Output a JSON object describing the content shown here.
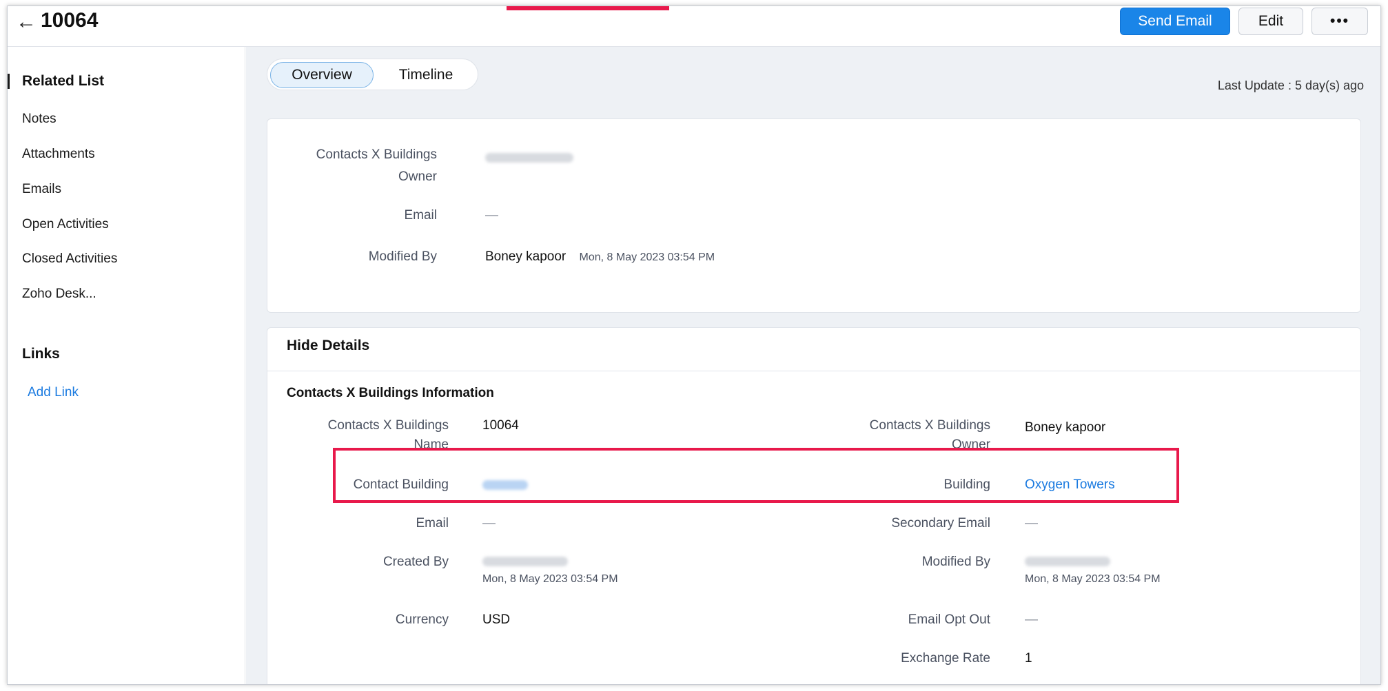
{
  "header": {
    "title": "10064",
    "send_email": "Send Email",
    "edit": "Edit",
    "more": "•••"
  },
  "sidebar": {
    "related_heading": "Related List",
    "items": [
      {
        "label": "Notes"
      },
      {
        "label": "Attachments"
      },
      {
        "label": "Emails"
      },
      {
        "label": "Open Activities"
      },
      {
        "label": "Closed Activities"
      },
      {
        "label": "Zoho Desk..."
      }
    ],
    "links_heading": "Links",
    "add_link": "Add Link"
  },
  "tabs": {
    "overview": "Overview",
    "timeline": "Timeline"
  },
  "last_update": "Last Update : 5 day(s) ago",
  "summary": {
    "owner_label_1": "Contacts X Buildings",
    "owner_label_2": "Owner",
    "email_label": "Email",
    "email_value": "—",
    "modified_by_label": "Modified By",
    "modified_by_value": "Boney kapoor",
    "modified_time": "Mon, 8 May 2023 03:54 PM"
  },
  "details": {
    "hide_details": "Hide Details",
    "section_title": "Contacts X Buildings Information",
    "name_label_1": "Contacts X Buildings",
    "name_label_2": "Name",
    "name_value": "10064",
    "owner_label_1": "Contacts X Buildings",
    "owner_label_2": "Owner",
    "owner_value": "Boney kapoor",
    "contact_building_label": "Contact Building",
    "building_label": "Building",
    "building_value": "Oxygen Towers",
    "email_label": "Email",
    "email_value": "—",
    "secondary_email_label": "Secondary Email",
    "secondary_email_value": "—",
    "created_by_label": "Created By",
    "created_time": "Mon, 8 May 2023 03:54 PM",
    "modified_by_label": "Modified By",
    "modified_time": "Mon, 8 May 2023 03:54 PM",
    "currency_label": "Currency",
    "currency_value": "USD",
    "email_opt_out_label": "Email Opt Out",
    "email_opt_out_value": "—",
    "exchange_rate_label": "Exchange Rate",
    "exchange_rate_value": "1"
  },
  "colors": {
    "accent": "#1a85e8",
    "highlight": "#e8194b",
    "link": "#1a7ae0"
  },
  "icons": {
    "back": "back-arrow-icon"
  }
}
